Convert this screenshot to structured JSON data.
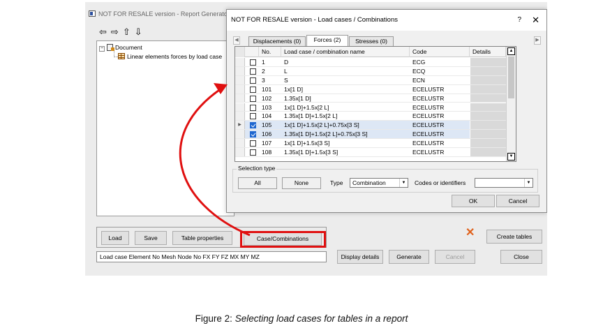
{
  "background_window": {
    "title": "NOT FOR RESALE version - Report Generato",
    "nav_icons": [
      "arrow-left-icon",
      "arrow-right-icon",
      "arrow-up-icon",
      "arrow-down-icon"
    ],
    "tree": {
      "root_expander": "−",
      "root_label": "Document",
      "child_label": "Linear elements forces by load case"
    },
    "buttons": {
      "load": "Load",
      "save": "Save",
      "table_properties": "Table properties",
      "case_combinations": "Case/Combinations",
      "create_tables": "Create tables",
      "display_details": "Display details",
      "generate": "Generate",
      "cancel": "Cancel",
      "close": "Close"
    },
    "fields_bar": "Load case  Element No  Mesh  Node No  FX  FY  FZ  MX  MY  MZ",
    "delete_icon": "✕"
  },
  "dialog": {
    "title": "NOT FOR RESALE version - Load cases / Combinations",
    "help": "?",
    "close": "✕",
    "tabs": [
      "Displacements (0)",
      "Forces (2)",
      "Stresses (0)"
    ],
    "active_tab": 1,
    "columns": [
      "No.",
      "Load case / combination name",
      "Code",
      "Details"
    ],
    "rows": [
      {
        "no": "1",
        "name": "D",
        "code": "ECG",
        "checked": false
      },
      {
        "no": "2",
        "name": "L",
        "code": "ECQ",
        "checked": false
      },
      {
        "no": "3",
        "name": "S",
        "code": "ECN",
        "checked": false
      },
      {
        "no": "101",
        "name": "1x[1 D]",
        "code": "ECELUSTR",
        "checked": false
      },
      {
        "no": "102",
        "name": "1.35x[1 D]",
        "code": "ECELUSTR",
        "checked": false
      },
      {
        "no": "103",
        "name": "1x[1 D]+1.5x[2 L]",
        "code": "ECELUSTR",
        "checked": false
      },
      {
        "no": "104",
        "name": "1.35x[1 D]+1.5x[2 L]",
        "code": "ECELUSTR",
        "checked": false
      },
      {
        "no": "105",
        "name": "1x[1 D]+1.5x[2 L]+0.75x[3 S]",
        "code": "ECELUSTR",
        "checked": true,
        "current": true
      },
      {
        "no": "106",
        "name": "1.35x[1 D]+1.5x[2 L]+0.75x[3 S]",
        "code": "ECELUSTR",
        "checked": true
      },
      {
        "no": "107",
        "name": "1x[1 D]+1.5x[3 S]",
        "code": "ECELUSTR",
        "checked": false
      },
      {
        "no": "108",
        "name": "1.35x[1 D]+1.5x[3 S]",
        "code": "ECELUSTR",
        "checked": false
      }
    ],
    "selection_type": {
      "label": "Selection type",
      "all": "All",
      "none": "None",
      "type_label": "Type",
      "type_value": "Combination",
      "codes_label": "Codes or identifiers",
      "codes_value": ""
    },
    "ok": "OK",
    "cancel": "Cancel"
  },
  "annotation": {
    "highlight_color": "#e01010",
    "arrow_color": "#e01010"
  },
  "caption": {
    "prefix": "Figure 2: ",
    "text": "Selecting load cases for tables in a report"
  }
}
